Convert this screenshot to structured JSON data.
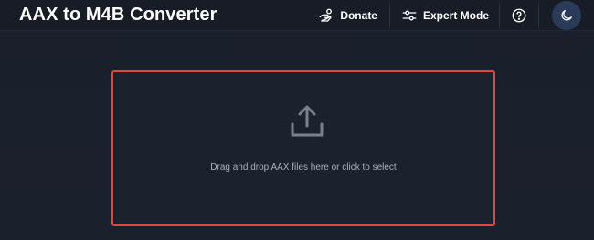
{
  "app": {
    "title": "AAX to M4B Converter"
  },
  "header": {
    "donate_label": "Donate",
    "expert_label": "Expert Mode",
    "icons": {
      "donate": "hand-coin-icon",
      "expert": "sliders-icon",
      "help": "question-circle-icon",
      "theme": "moon-icon"
    }
  },
  "dropzone": {
    "text": "Drag and drop AAX files here or click to select",
    "icon": "upload-icon",
    "border_color": "#e2483a"
  },
  "colors": {
    "background": "#1a202c",
    "header": "#171c26",
    "accent": "#e2483a",
    "theme_button": "#2a3b59"
  }
}
